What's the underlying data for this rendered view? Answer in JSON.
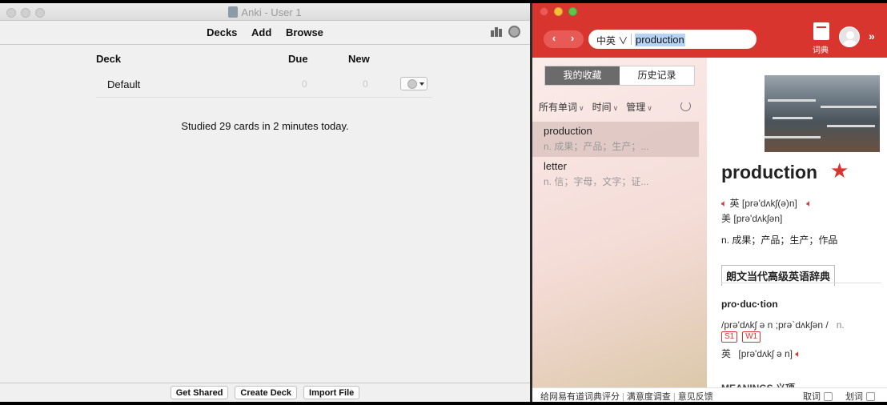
{
  "anki": {
    "window_title": "Anki - User 1",
    "nav": {
      "decks": "Decks",
      "add": "Add",
      "browse": "Browse"
    },
    "table": {
      "headers": {
        "deck": "Deck",
        "due": "Due",
        "new": "New"
      },
      "rows": [
        {
          "deck": "Default",
          "due": "0",
          "new": "0"
        }
      ]
    },
    "studied_text": "Studied 29 cards in 2 minutes today.",
    "bottom_buttons": {
      "get_shared": "Get Shared",
      "create_deck": "Create Deck",
      "import_file": "Import File"
    }
  },
  "youdao": {
    "colors": {
      "brand": "#d8352f"
    },
    "search": {
      "lang": "中英 ∨",
      "query": "production"
    },
    "dict_label": "词典",
    "tabs": {
      "favorites": "我的收藏",
      "history": "历史记录"
    },
    "filters": {
      "all_words": "所有单词",
      "time": "时间",
      "manage": "管理"
    },
    "word_list": [
      {
        "word": "production",
        "def": "n. 成果；产品；生产；..."
      },
      {
        "word": "letter",
        "def": "n. 信；字母，文字；证..."
      }
    ],
    "entry": {
      "word": "production",
      "uk_label": "英",
      "uk_ipa": "[prə'dʌkʃ(ə)n]",
      "us_label": "美",
      "us_ipa": "[prə'dʌkʃən]",
      "meaning": "n. 成果；产品；生产；作品",
      "dict_name": "朗文当代高级英语辞典",
      "syllables": "pro·duc·tion",
      "ipa_line": "/prə'dʌkʃ ə n ;prə`dʌkʃən /",
      "pos": "n.",
      "badges": [
        "S1",
        "W1"
      ],
      "uk_label2": "英",
      "uk_ipa2": "[prə'dʌkʃ ə n]",
      "cutoff_text": "MEANINGS 义项"
    },
    "footer": {
      "rate": "给网易有道词典评分",
      "survey": "满意度调查",
      "feedback": "意见反馈",
      "fetch": "取词",
      "select": "划词"
    }
  }
}
